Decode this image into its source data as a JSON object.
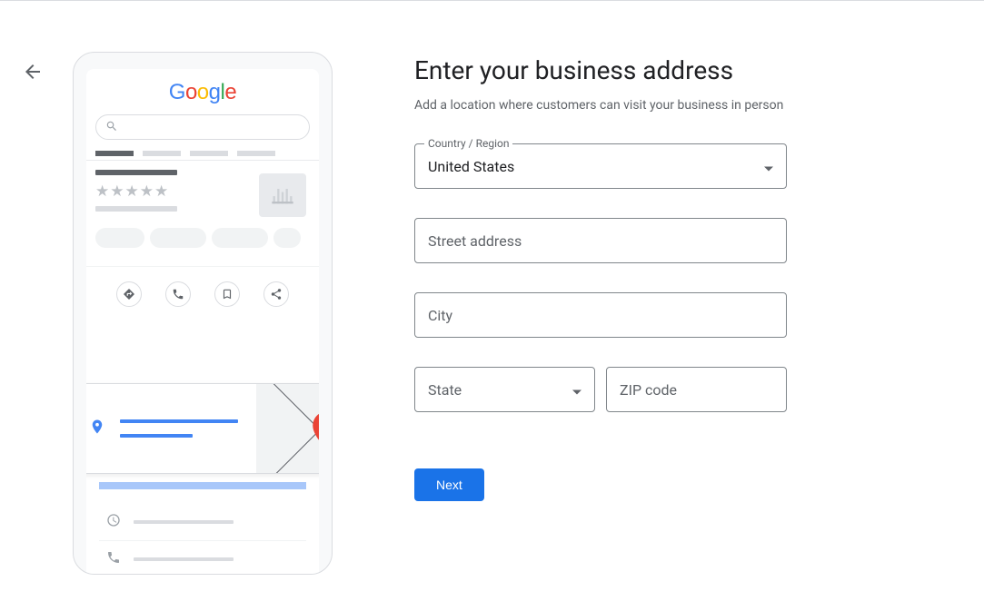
{
  "header": {
    "back_icon": "arrow-left"
  },
  "illustration": {
    "logo_text": "Google",
    "search_icon": "search"
  },
  "form": {
    "title": "Enter your business address",
    "subtitle": "Add a location where customers can visit your business in person",
    "country_label": "Country / Region",
    "country_value": "United States",
    "street_placeholder": "Street address",
    "city_placeholder": "City",
    "state_placeholder": "State",
    "zip_placeholder": "ZIP code",
    "next_button": "Next"
  }
}
